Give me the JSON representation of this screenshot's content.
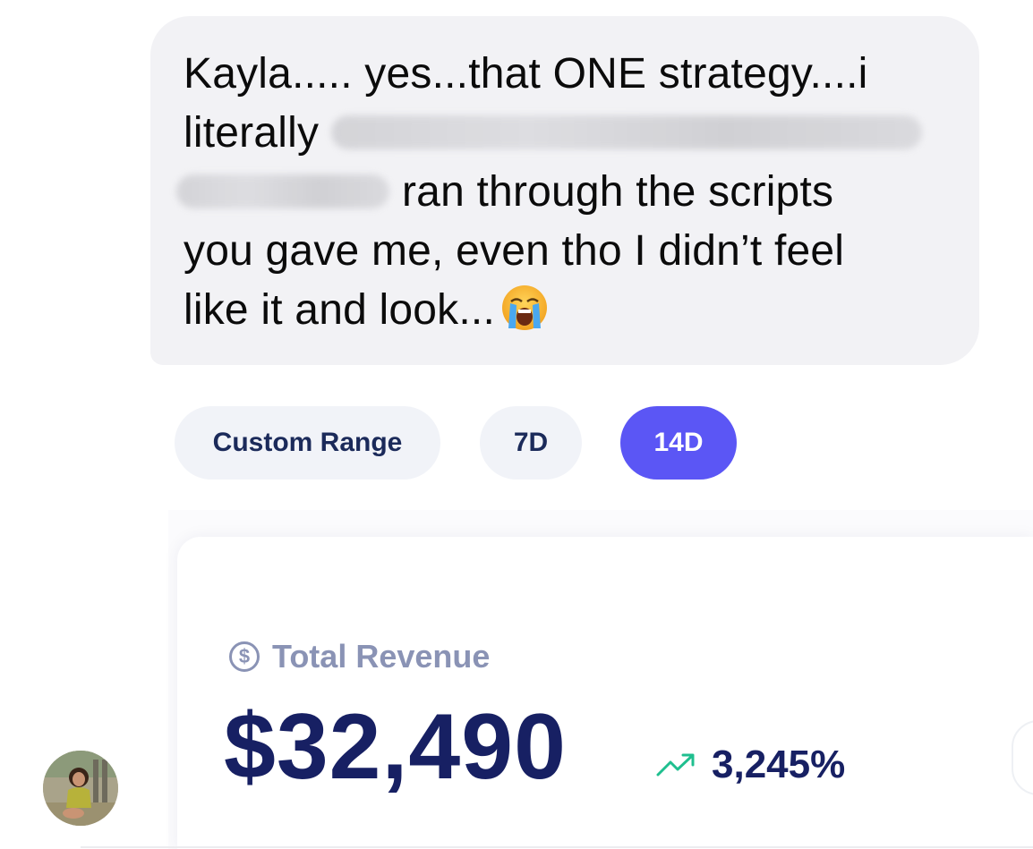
{
  "message": {
    "line1": "Kayla..... yes...that ONE strategy....i",
    "line2_start": "literally",
    "line3_end": "ran through the scripts",
    "line4": "you gave me, even tho I didn’t feel",
    "line5": "like it and look...",
    "emoji": "loudly-crying-face"
  },
  "dashboard": {
    "tabs": [
      {
        "label": "Custom Range",
        "active": false
      },
      {
        "label": "7D",
        "active": false
      },
      {
        "label": "14D",
        "active": true
      }
    ],
    "accent_color": "#5b56f5",
    "revenue": {
      "label": "Total Revenue",
      "icon": "dollar-circle-icon",
      "value": "$32,490",
      "change": "3,245%",
      "change_icon": "trend-up-icon",
      "change_color": "#1fbf8f"
    }
  },
  "sender": {
    "avatar": "avatar"
  }
}
